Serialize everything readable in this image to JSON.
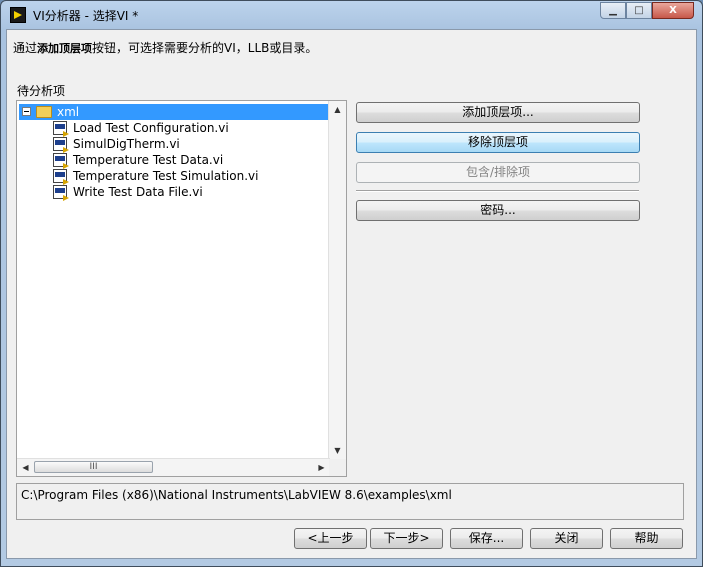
{
  "window": {
    "title": "VI分析器 - 选择VI *",
    "caption_buttons": {
      "minimize": "▁",
      "maximize": "□",
      "close": "X"
    }
  },
  "instructions": {
    "prefix": "通过",
    "bold": "添加顶层项",
    "suffix": "按钮，可选择需要分析的VI，LLB或目录。"
  },
  "tree": {
    "label": "待分析项",
    "root": {
      "name": "xml",
      "expander": "minus",
      "icon": "folder-icon",
      "selected": true
    },
    "items": [
      {
        "name": "Load Test Configuration.vi",
        "icon": "vi-icon"
      },
      {
        "name": "SimulDigTherm.vi",
        "icon": "vi-icon"
      },
      {
        "name": "Temperature Test Data.vi",
        "icon": "vi-icon"
      },
      {
        "name": "Temperature Test Simulation.vi",
        "icon": "vi-icon"
      },
      {
        "name": "Write Test Data File.vi",
        "icon": "vi-icon"
      }
    ],
    "scroll": {
      "up": "▲",
      "down": "▼",
      "left": "◀",
      "right": "▶",
      "thumb_grip": "III"
    }
  },
  "actions": {
    "add_top_level": "添加顶层项...",
    "remove_top_level": "移除顶层项",
    "include_exclude": "包含/排除项",
    "password": "密码..."
  },
  "path": "C:\\Program Files (x86)\\National Instruments\\LabVIEW 8.6\\examples\\xml",
  "footer": {
    "back": "<上一步",
    "next": "下一步>",
    "save": "保存...",
    "close": "关闭",
    "help": "帮助"
  },
  "colors": {
    "selection": "#3399ff",
    "focused_button": "#bee6fd",
    "title_bar": "#bcd3ec"
  }
}
